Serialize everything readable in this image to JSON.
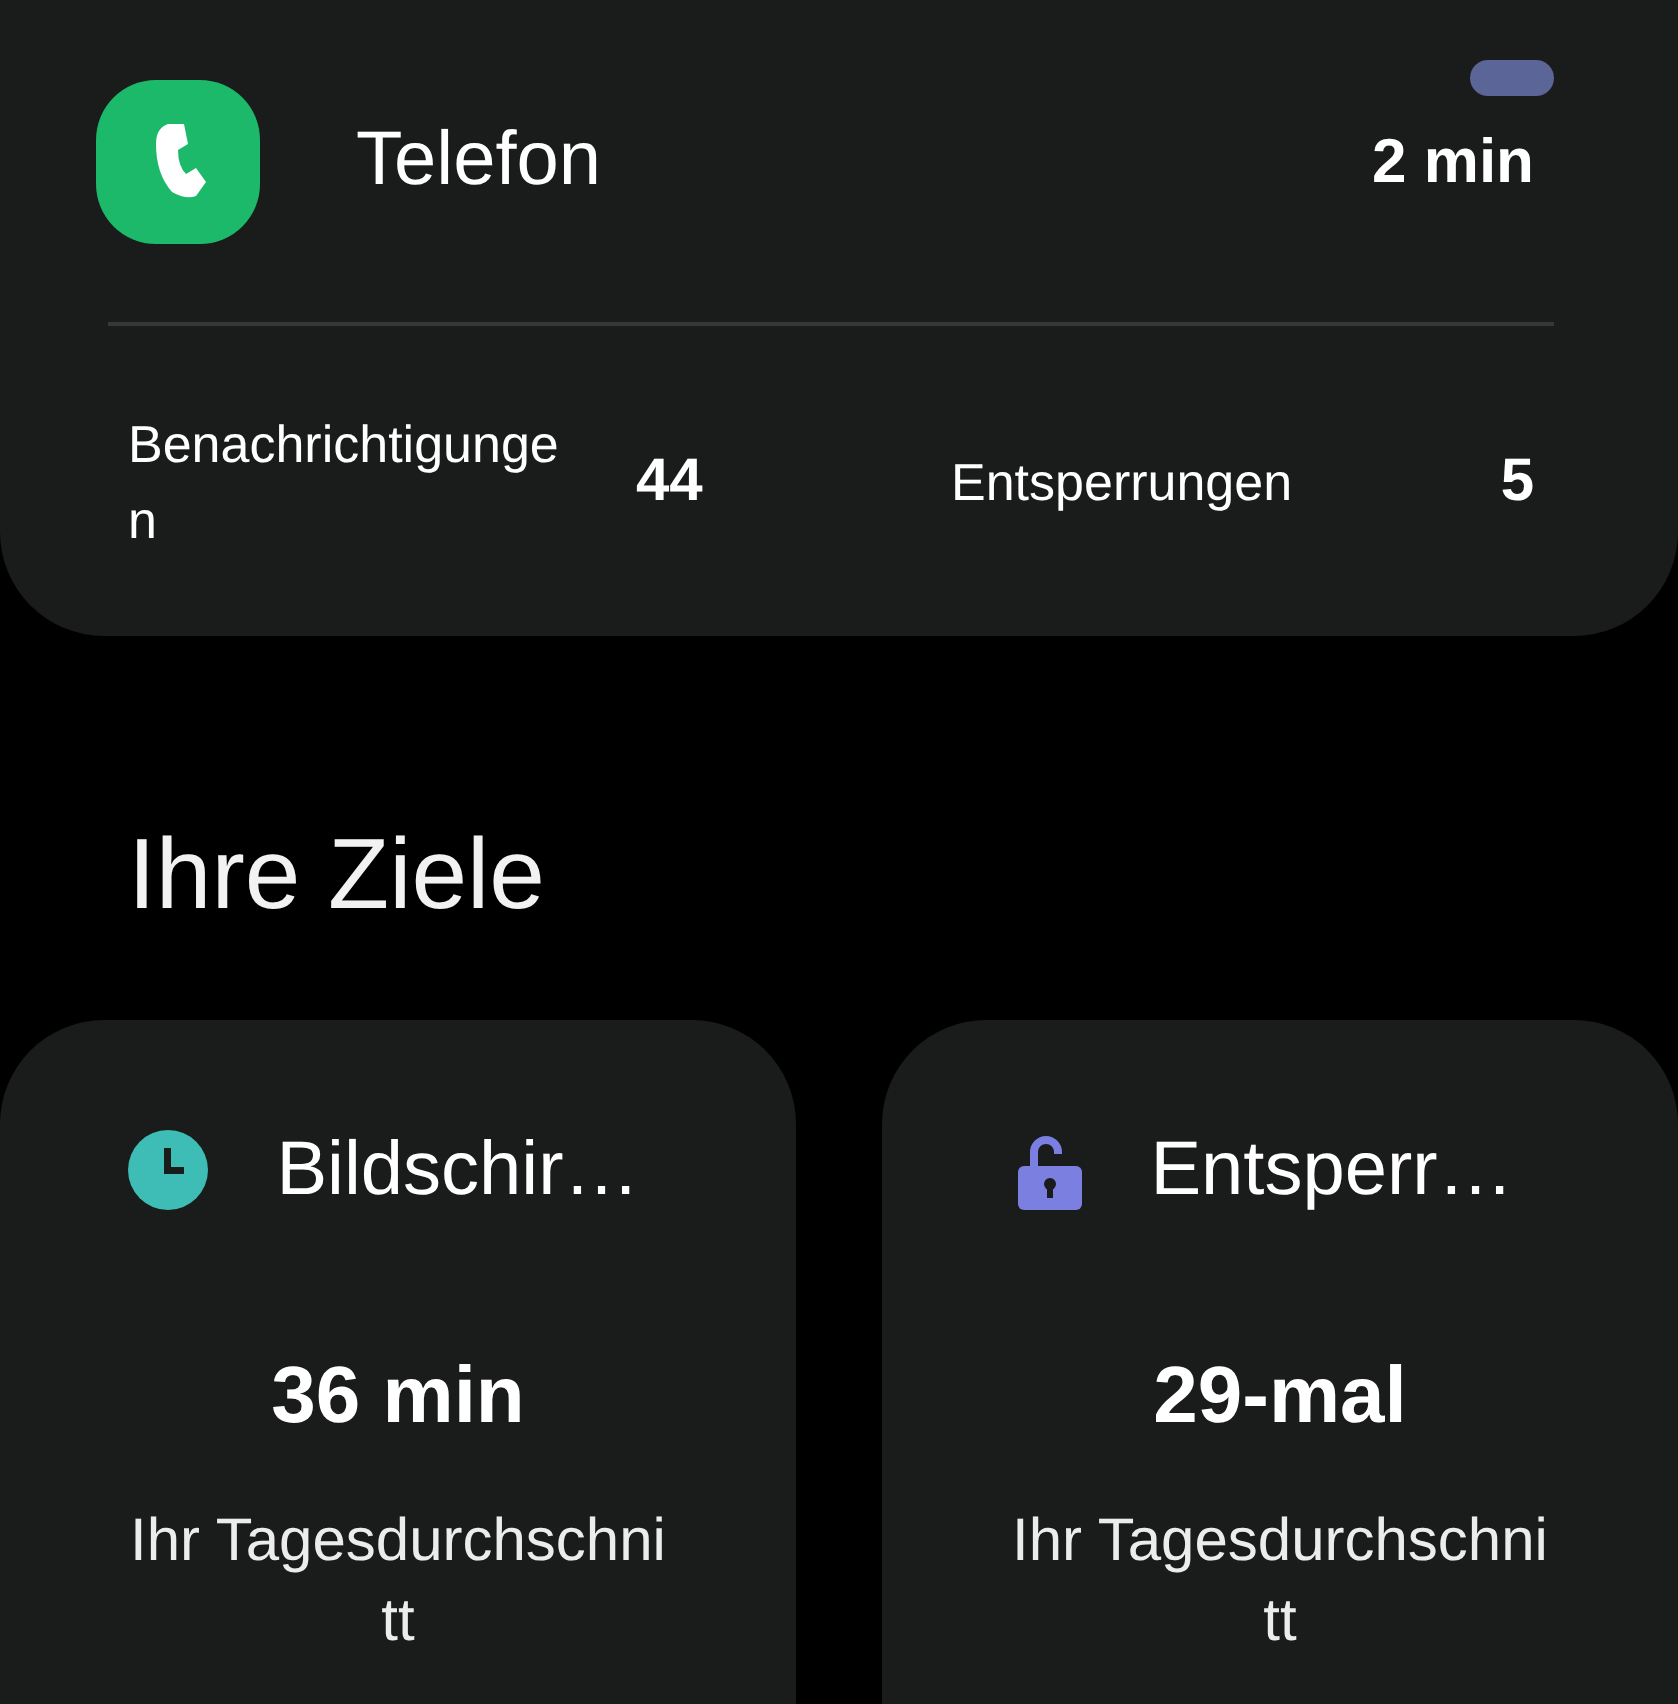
{
  "app": {
    "name": "Telefon",
    "usage": "2 min",
    "stats": [
      {
        "label": "Benachrichtigungen",
        "value": "44"
      },
      {
        "label": "Entsperrungen",
        "value": "5"
      }
    ]
  },
  "goals": {
    "title": "Ihre Ziele",
    "cards": [
      {
        "kind": "screen_time",
        "title": "Bildschir…",
        "value": "36 min",
        "caption": "Ihr Tagesdurchschnitt"
      },
      {
        "kind": "unlocks",
        "title": "Entsperr…",
        "value": "29-mal",
        "caption": "Ihr Tagesdurchschnitt"
      }
    ]
  }
}
